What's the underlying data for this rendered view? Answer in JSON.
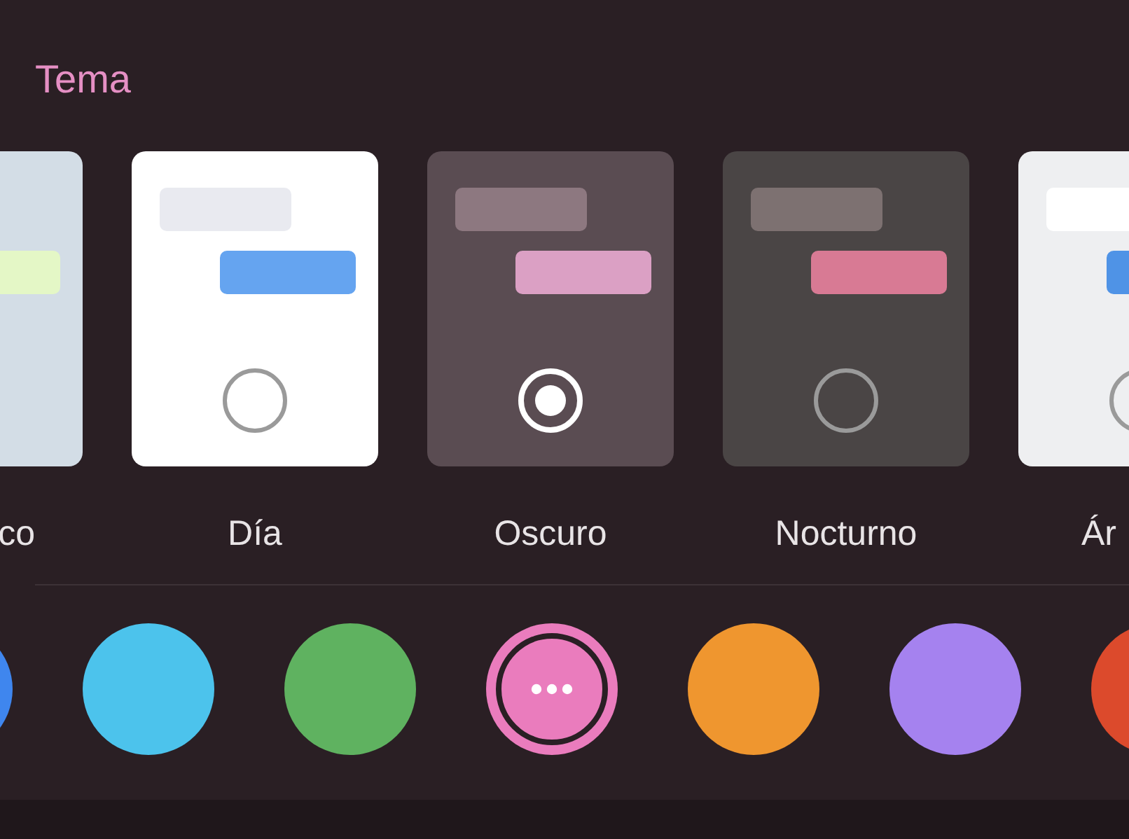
{
  "title": "Tema",
  "themes": [
    {
      "label": "co",
      "color": "#d3dde6",
      "bubbles": [
        {
          "kind": "outgoing",
          "color": "#e4f7c6"
        }
      ]
    },
    {
      "label": "Día",
      "selected": false,
      "color": "#ffffff",
      "bubbles": [
        {
          "kind": "incoming",
          "color": "#e9eaf0"
        },
        {
          "kind": "outgoing",
          "color": "#65a4f0"
        }
      ]
    },
    {
      "label": "Oscuro",
      "selected": true,
      "color": "#5a4c52",
      "bubbles": [
        {
          "kind": "incoming",
          "color": "#8d7880"
        },
        {
          "kind": "outgoing",
          "color": "#dba0c4"
        }
      ]
    },
    {
      "label": "Nocturno",
      "selected": false,
      "color": "#4a4545",
      "bubbles": [
        {
          "kind": "incoming",
          "color": "#7d7171"
        },
        {
          "kind": "outgoing",
          "color": "#d87a94"
        }
      ]
    },
    {
      "label": "Ár",
      "selected": false,
      "color": "#eeeff1",
      "bubbles": [
        {
          "kind": "incoming",
          "color": "#ffffff"
        },
        {
          "kind": "outgoing",
          "color": "#4f93e6"
        }
      ]
    }
  ],
  "accent_colors": [
    {
      "color": "#3f86ee",
      "selected": false
    },
    {
      "color": "#4cc3ec",
      "selected": false
    },
    {
      "color": "#5fb260",
      "selected": false
    },
    {
      "color": "#ea7cbd",
      "selected": true
    },
    {
      "color": "#ef962f",
      "selected": false
    },
    {
      "color": "#a582ef",
      "selected": false
    },
    {
      "color": "#dc4a2c",
      "selected": false
    }
  ]
}
